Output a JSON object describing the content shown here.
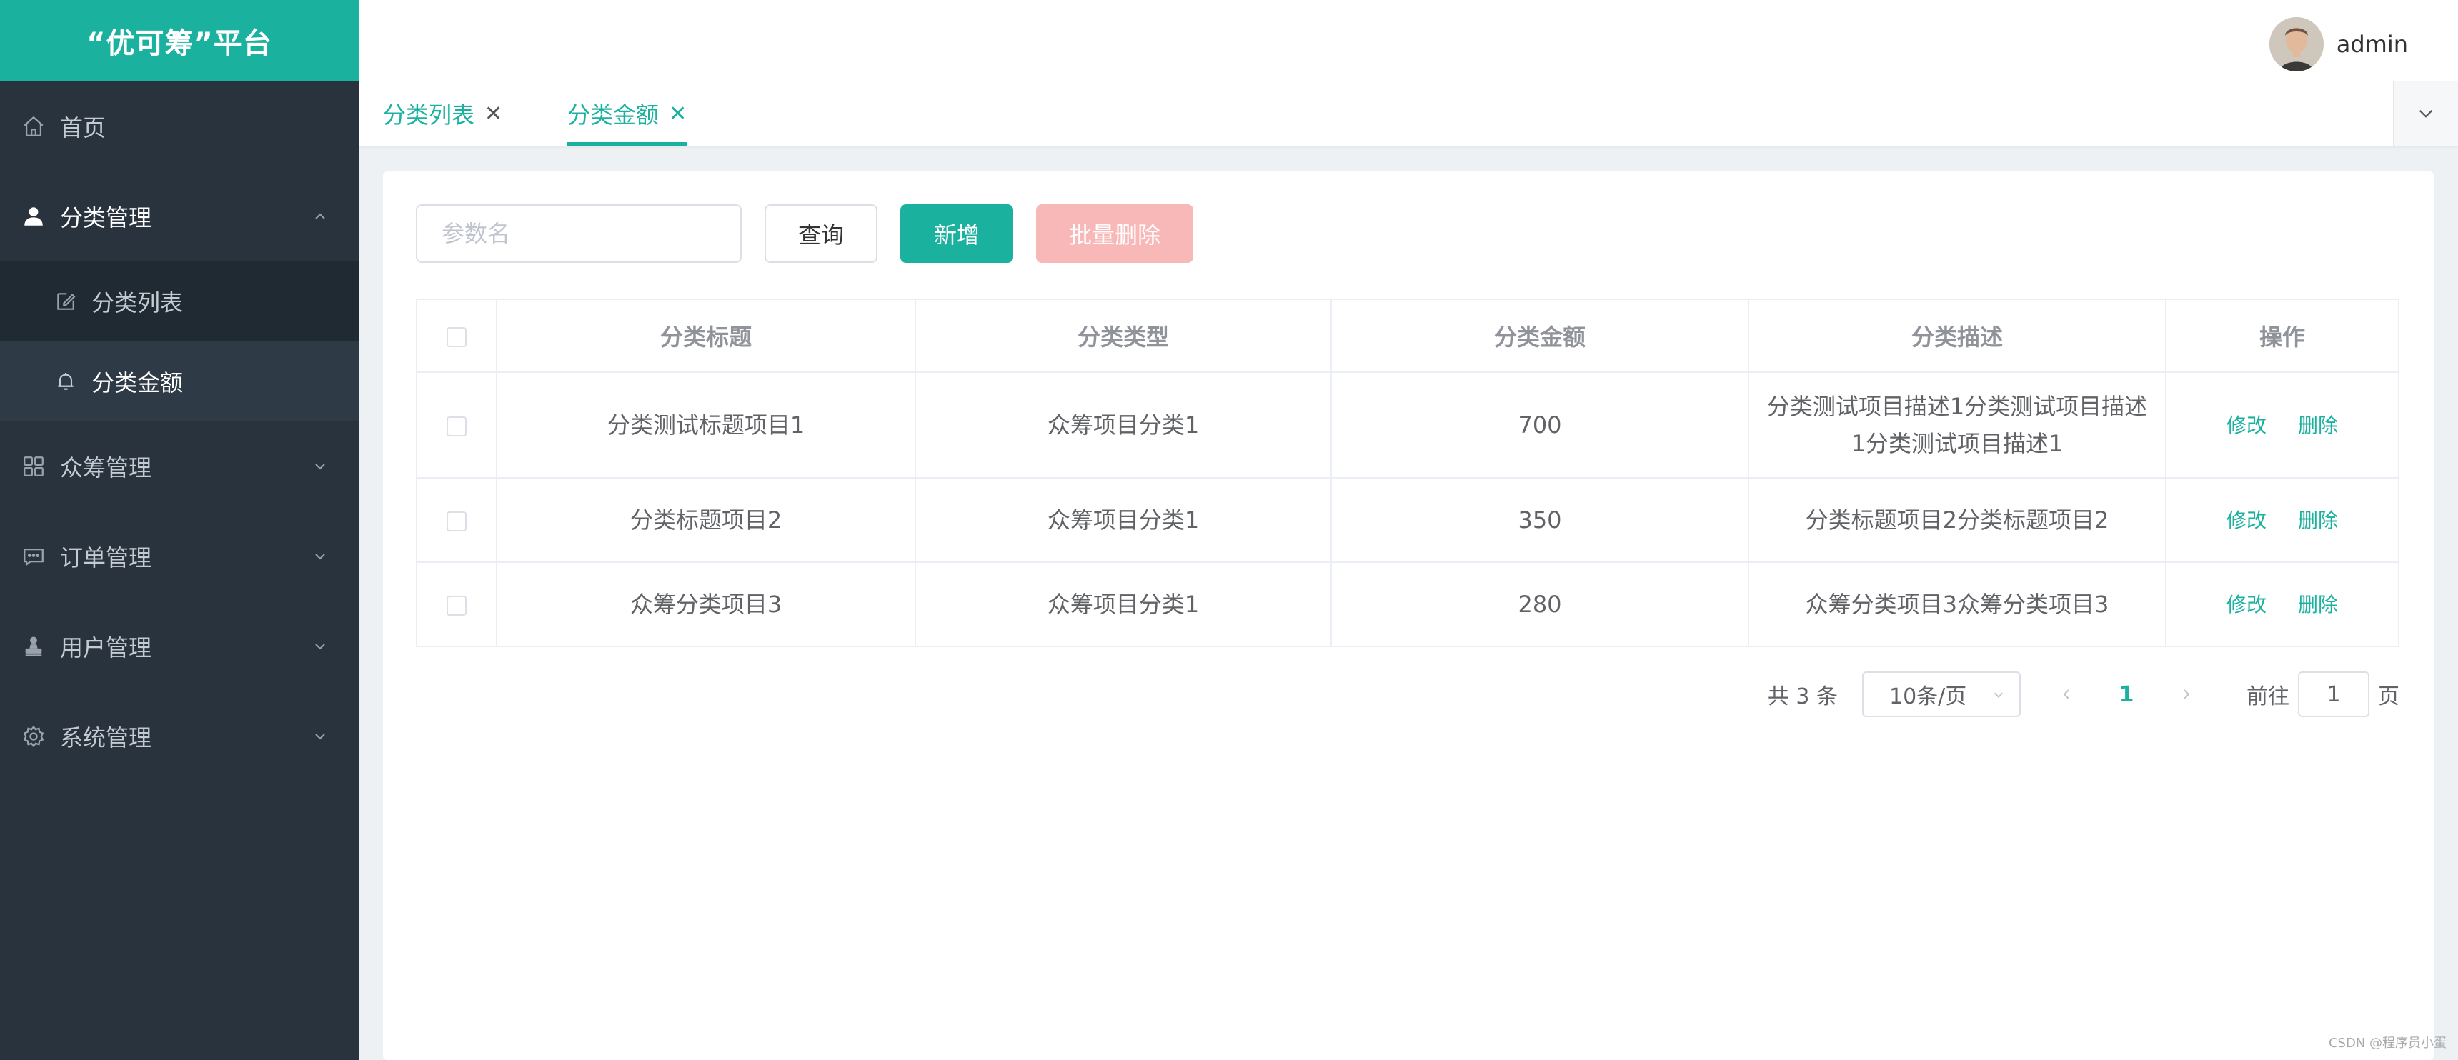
{
  "app": {
    "title": "“优可筹”平台"
  },
  "sidebar": {
    "items": [
      {
        "label": "首页",
        "icon": "home-icon"
      },
      {
        "label": "分类管理",
        "icon": "user-icon",
        "open": true,
        "children": [
          {
            "label": "分类列表",
            "icon": "edit-icon"
          },
          {
            "label": "分类金额",
            "icon": "bell-icon",
            "active": true
          }
        ]
      },
      {
        "label": "众筹管理",
        "icon": "grid-icon"
      },
      {
        "label": "订单管理",
        "icon": "chat-icon"
      },
      {
        "label": "用户管理",
        "icon": "stamp-icon"
      },
      {
        "label": "系统管理",
        "icon": "gear-icon"
      }
    ]
  },
  "header": {
    "user_name": "admin"
  },
  "tabs": [
    {
      "label": "分类列表",
      "close": "✕"
    },
    {
      "label": "分类金额",
      "close": "✕",
      "active": true
    }
  ],
  "toolbar": {
    "search_placeholder": "参数名",
    "query_label": "查询",
    "add_label": "新增",
    "batch_delete_label": "批量删除"
  },
  "table": {
    "columns": [
      "分类标题",
      "分类类型",
      "分类金额",
      "分类描述",
      "操作"
    ],
    "rows": [
      {
        "title": "分类测试标题项目1",
        "type": "众筹项目分类1",
        "amount": "700",
        "desc": "分类测试项目描述1分类测试项目描述1分类测试项目描述1"
      },
      {
        "title": "分类标题项目2",
        "type": "众筹项目分类1",
        "amount": "350",
        "desc": "分类标题项目2分类标题项目2"
      },
      {
        "title": "众筹分类项目3",
        "type": "众筹项目分类1",
        "amount": "280",
        "desc": "众筹分类项目3众筹分类项目3"
      }
    ],
    "edit_label": "修改",
    "delete_label": "删除"
  },
  "pagination": {
    "total_text": "共 3 条",
    "page_size": "10条/页",
    "current_page": "1",
    "goto_label": "前往",
    "goto_value": "1",
    "goto_suffix": "页"
  },
  "watermark": "CSDN @程序员小蛋",
  "colors": {
    "accent": "#1bb19f",
    "sidebar": "#28333e",
    "danger_disabled": "#f9b8b8"
  }
}
